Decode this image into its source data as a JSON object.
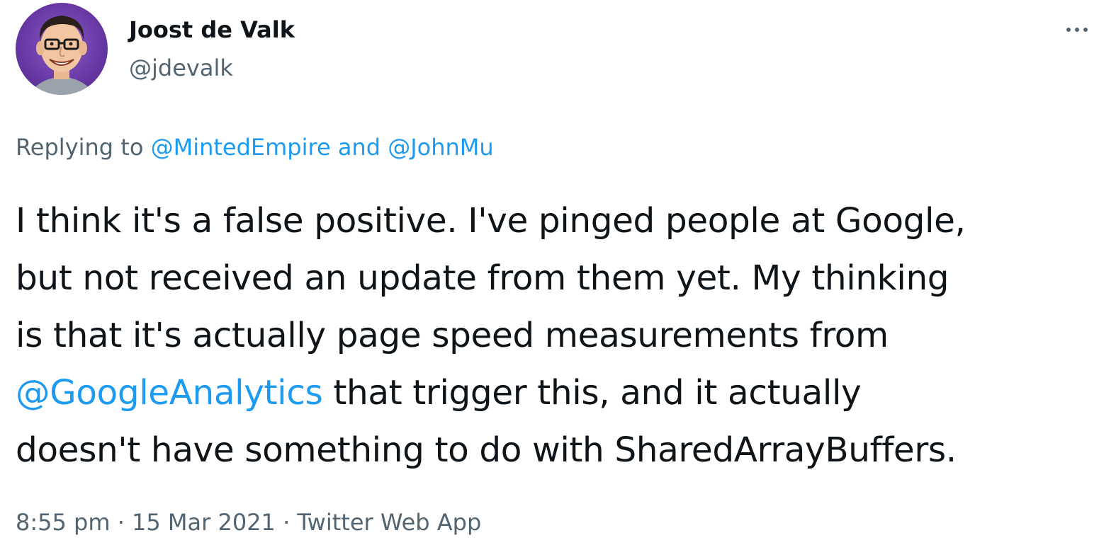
{
  "author": {
    "display_name": "Joost de Valk",
    "handle": "@jdevalk"
  },
  "reply_context": {
    "prefix": "Replying to ",
    "mention_1": "@MintedEmpire",
    "joiner": " and ",
    "mention_2": "@JohnMu"
  },
  "tweet": {
    "line_1": "I think it's a false positive. I've pinged people at Google,",
    "line_2": "but not received an update from them yet. My thinking",
    "line_3": "is that it's actually page speed measurements from",
    "line_4_mention": "@GoogleAnalytics",
    "line_4_rest": " that trigger this, and it actually",
    "line_5": "doesn't have something to do with SharedArrayBuffers."
  },
  "meta": {
    "time": "8:55 pm",
    "sep_1": " · ",
    "date": "15 Mar 2021",
    "sep_2": " · ",
    "source": "Twitter Web App"
  },
  "icons": {
    "more": "more-horizontal-icon",
    "avatar": "avatar-caricature"
  },
  "colors": {
    "text": "#0f1419",
    "secondary": "#536471",
    "link": "#1d9bf0",
    "avatar_bg": "#6a3aa6"
  }
}
